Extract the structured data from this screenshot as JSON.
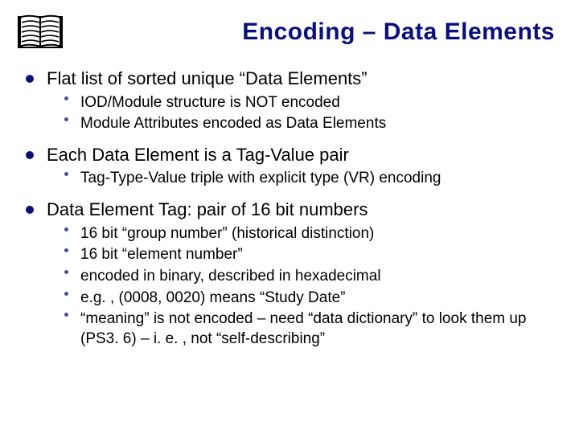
{
  "title": "Encoding – Data Elements",
  "bullets": [
    {
      "text": "Flat list of sorted unique “Data Elements”",
      "sub": [
        "IOD/Module structure is NOT encoded",
        "Module Attributes encoded as Data Elements"
      ]
    },
    {
      "text": "Each Data Element is a Tag-Value pair",
      "sub": [
        "Tag-Type-Value triple with explicit type (VR) encoding"
      ]
    },
    {
      "text": "Data Element Tag: pair of 16 bit numbers",
      "sub": [
        "16 bit “group number” (historical distinction)",
        "16 bit “element number”",
        "encoded in binary, described in hexadecimal",
        "e.g. , (0008, 0020) means “Study Date”",
        "“meaning” is not encoded – need “data dictionary” to look them up (PS3. 6) – i. e. , not “self-describing”"
      ]
    }
  ]
}
